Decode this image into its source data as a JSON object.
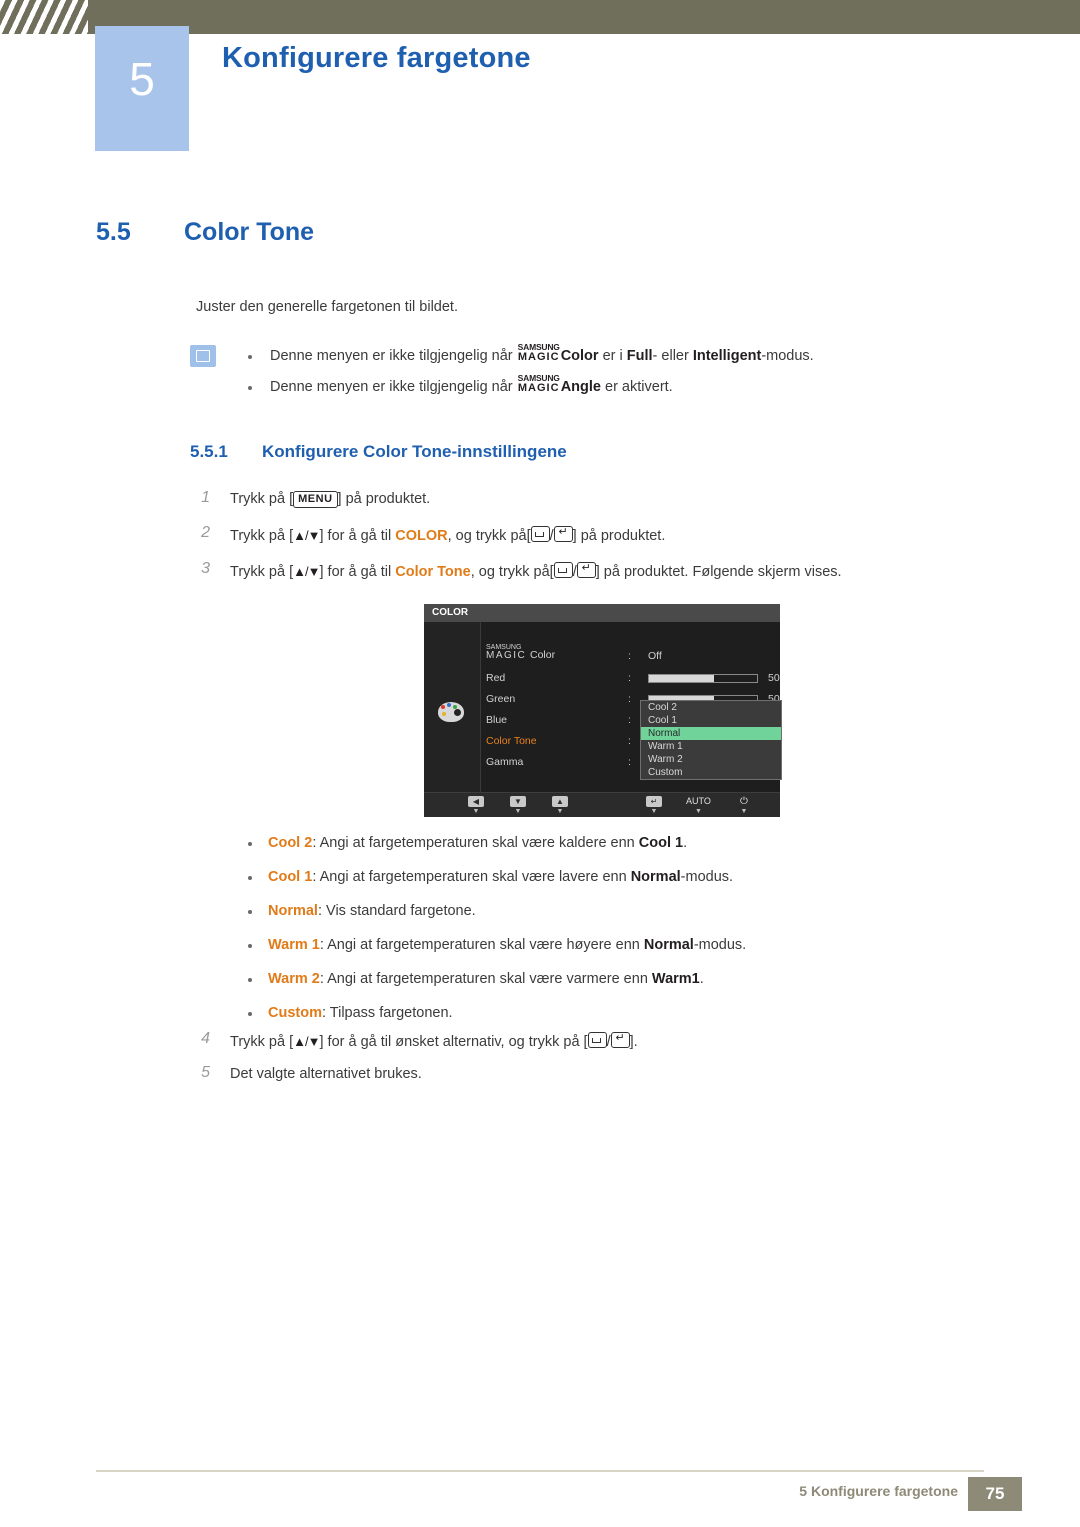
{
  "header": {
    "chapter_number": "5",
    "chapter_title": "Konfigurere fargetone"
  },
  "section": {
    "number": "5.5",
    "title": "Color Tone",
    "intro": "Juster den generelle fargetonen til bildet."
  },
  "notes": [
    {
      "pre": "Denne menyen er ikke tilgjengelig når ",
      "magic_small": "SAMSUNG",
      "magic_big": "MAGIC",
      "magic_word": "Color",
      "mid": " er i ",
      "b1": "Full",
      "mid2": "- eller ",
      "b2": "Intelligent",
      "post": "-modus."
    },
    {
      "pre": "Denne menyen er ikke tilgjengelig når ",
      "magic_small": "SAMSUNG",
      "magic_big": "MAGIC",
      "magic_word": "Angle",
      "mid": " er aktivert.",
      "b1": "",
      "mid2": "",
      "b2": "",
      "post": ""
    }
  ],
  "subsection": {
    "number": "5.5.1",
    "title": "Konfigurere Color Tone-innstillingene"
  },
  "steps": {
    "s1_num": "1",
    "s1_a": "Trykk på [",
    "s1_key": "MENU",
    "s1_b": "] på produktet.",
    "s2_num": "2",
    "s2_a": "Trykk på [",
    "s2_b": "] for å gå til ",
    "s2_target": "COLOR",
    "s2_c": ", og trykk på[",
    "s2_d": "] på produktet.",
    "s3_num": "3",
    "s3_a": "Trykk på [",
    "s3_b": "] for å gå til ",
    "s3_target": "Color Tone",
    "s3_c": ", og trykk på[",
    "s3_d": "] på produktet. Følgende skjerm vises.",
    "s4_num": "4",
    "s4_a": "Trykk på [",
    "s4_b": "] for å gå til ønsket alternativ, og trykk på [",
    "s4_c": "].",
    "s5_num": "5",
    "s5_text": "Det valgte alternativet brukes.",
    "updown": "▲/▼"
  },
  "osd": {
    "title": "COLOR",
    "magic_small": "SAMSUNG",
    "magic_big": "MAGIC",
    "magic_word": "Color",
    "magic_value": "Off",
    "rows": [
      {
        "label": "Red",
        "colon": ":",
        "value": "50",
        "bar": 60
      },
      {
        "label": "Green",
        "colon": ":",
        "value": "50",
        "bar": 60
      },
      {
        "label": "Blue",
        "colon": ":",
        "value": "",
        "bar": 0
      },
      {
        "label": "Color Tone",
        "colon": ":",
        "value": "",
        "bar": 0
      },
      {
        "label": "Gamma",
        "colon": ":",
        "value": "",
        "bar": 0
      }
    ],
    "dropdown": [
      {
        "label": "Cool 2",
        "selected": false
      },
      {
        "label": "Cool 1",
        "selected": false
      },
      {
        "label": "Normal",
        "selected": true
      },
      {
        "label": "Warm 1",
        "selected": false
      },
      {
        "label": "Warm 2",
        "selected": false
      },
      {
        "label": "Custom",
        "selected": false
      }
    ],
    "footer": [
      {
        "icon": "◀",
        "caption": "▼"
      },
      {
        "icon": "▼",
        "caption": "▼"
      },
      {
        "icon": "▲",
        "caption": "▼"
      },
      {
        "icon": "↵",
        "caption": "▼"
      },
      {
        "icon": "AUTO",
        "caption": "▼"
      },
      {
        "icon": "⏻",
        "caption": "▼"
      }
    ]
  },
  "tones": [
    {
      "name": "Cool 2",
      "sep": ": ",
      "text_a": "Angi at fargetemperaturen skal være kaldere enn ",
      "bold": "Cool 1",
      "text_b": "."
    },
    {
      "name": "Cool 1",
      "sep": ": ",
      "text_a": "Angi at fargetemperaturen skal være lavere enn ",
      "bold": "Normal",
      "text_b": "-modus."
    },
    {
      "name": "Normal",
      "sep": ": ",
      "text_a": "Vis standard fargetone.",
      "bold": "",
      "text_b": ""
    },
    {
      "name": "Warm 1",
      "sep": ": ",
      "text_a": "Angi at fargetemperaturen skal være høyere enn ",
      "bold": "Normal",
      "text_b": "-modus."
    },
    {
      "name": "Warm 2",
      "sep": ": ",
      "text_a": "Angi at fargetemperaturen skal være varmere enn ",
      "bold": "Warm1",
      "text_b": "."
    },
    {
      "name": "Custom",
      "sep": ": ",
      "text_a": "Tilpass fargetonen.",
      "bold": "",
      "text_b": ""
    }
  ],
  "footer": {
    "label": "5 Konfigurere fargetone",
    "page": "75"
  },
  "colors": {
    "header_bar": "#6f6f5c",
    "badge": "#a8c4ea",
    "heading_blue": "#1f5fb0",
    "accent_orange": "#e07b18",
    "osd_highlight": "#6fd39a"
  }
}
